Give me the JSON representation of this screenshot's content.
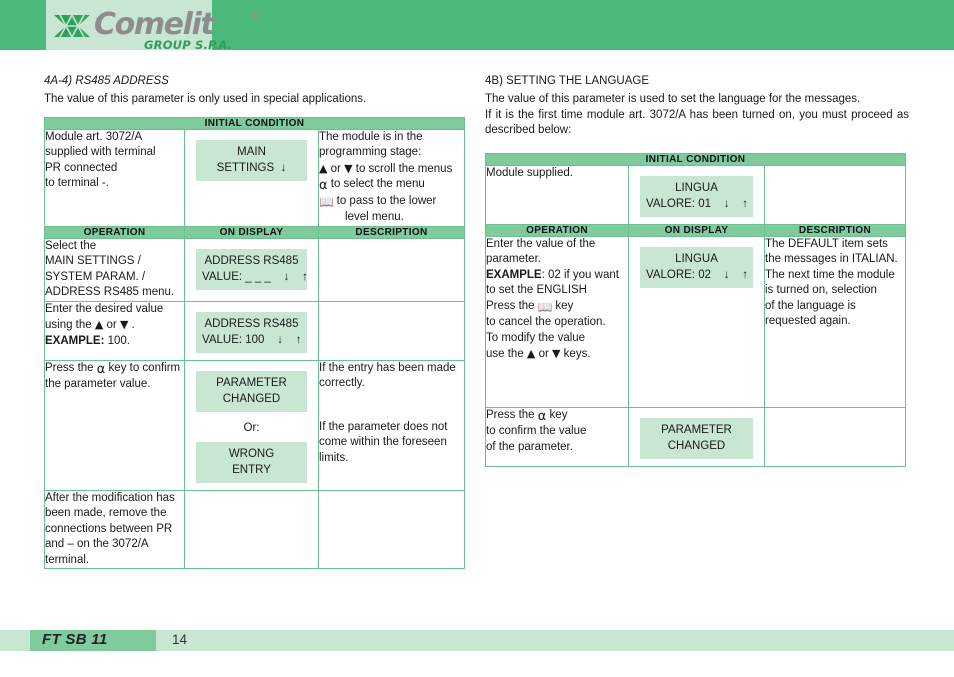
{
  "header": {
    "logo_text": "Comelit",
    "logo_registered": "®",
    "logo_subtitle": "GROUP S.P.A.",
    "brand_green": "#4bb97c",
    "plate_green": "#c9e6d3"
  },
  "left_section": {
    "heading": "4A-4)  RS485 ADDRESS",
    "intro": "The value of this parameter is only used in special applications.",
    "initial_condition_label": "INITIAL CONDITION",
    "initial_row": {
      "operation": [
        "Module art. 3072/A",
        "supplied with terminal",
        "PR connected",
        "to terminal -."
      ],
      "display_line1": "MAIN",
      "display_line2": "SETTINGS  ↓",
      "description": [
        "The module is in the",
        "programming stage:",
        "▲ or ▼ to scroll the menus",
        "BELL to select the menu",
        "BOOK to pass to the lower",
        "level menu."
      ]
    },
    "columns": {
      "operation": "OPERATION",
      "on_display": "ON DISPLAY",
      "description": "DESCRIPTION"
    },
    "rows": [
      {
        "operation": [
          "Select the",
          "MAIN SETTINGS /",
          "SYSTEM PARAM. /",
          "ADDRESS RS485 menu."
        ],
        "display_line1": "ADDRESS RS485",
        "display_line2": "VALUE: _ _ _    ↓    ↑",
        "description": []
      },
      {
        "operation": [
          "Enter the desired value",
          "using the ▲ or ▼ .",
          "EXAMPLE: 100."
        ],
        "display_line1": "ADDRESS RS485",
        "display_line2": "VALUE: 100    ↓    ↑",
        "description": []
      },
      {
        "operation": [
          "Press the BELL key to confirm",
          "the parameter value."
        ],
        "display_line1": "PARAMETER",
        "display_line2": "CHANGED",
        "display_or": "Or:",
        "display2_line1": "WRONG",
        "display2_line2": "ENTRY",
        "description_a": [
          "If the entry has been made",
          "correctly."
        ],
        "description_b": [
          "If the parameter does not",
          "come within the foreseen limits."
        ]
      },
      {
        "operation": [
          "After the modification has",
          "been made, remove the",
          "connections between PR",
          "and – on the 3072/A terminal."
        ],
        "display_line1": "",
        "display_line2": "",
        "description": []
      }
    ]
  },
  "right_section": {
    "heading": "4B) SETTING THE LANGUAGE",
    "intro_line1": "The value of this parameter is used to set the language for the messages.",
    "intro_line2": "If it is the first time module art. 3072/A has been turned on, you must proceed as described below:",
    "initial_condition_label": "INITIAL CONDITION",
    "initial_row": {
      "operation": [
        "Module supplied."
      ],
      "display_line1": "LINGUA",
      "display_line2": "VALORE: 01    ↓    ↑",
      "description": []
    },
    "columns": {
      "operation": "OPERATION",
      "on_display": "ON DISPLAY",
      "description": "DESCRIPTION"
    },
    "rows": [
      {
        "operation": [
          "Enter the value of the",
          "parameter.",
          "EXAMPLE: 02 if you want",
          "to set the ENGLISH",
          "Press the BOOK key",
          "to cancel the operation.",
          "To modify the value",
          "use the ▲ or ▼ keys."
        ],
        "display_line1": "LINGUA",
        "display_line2": "VALORE: 02    ↓    ↑",
        "description": [
          "The DEFAULT item sets",
          "the messages in ITALIAN.",
          "The next time the module",
          "is turned on, selection",
          "of the language is",
          "requested again."
        ]
      },
      {
        "operation": [
          "Press the BELL key",
          "to confirm the value",
          "of the parameter."
        ],
        "display_line1": "PARAMETER",
        "display_line2": "CHANGED",
        "description": []
      }
    ]
  },
  "footer": {
    "document_code": "FT SB 11",
    "page_number": "14"
  }
}
